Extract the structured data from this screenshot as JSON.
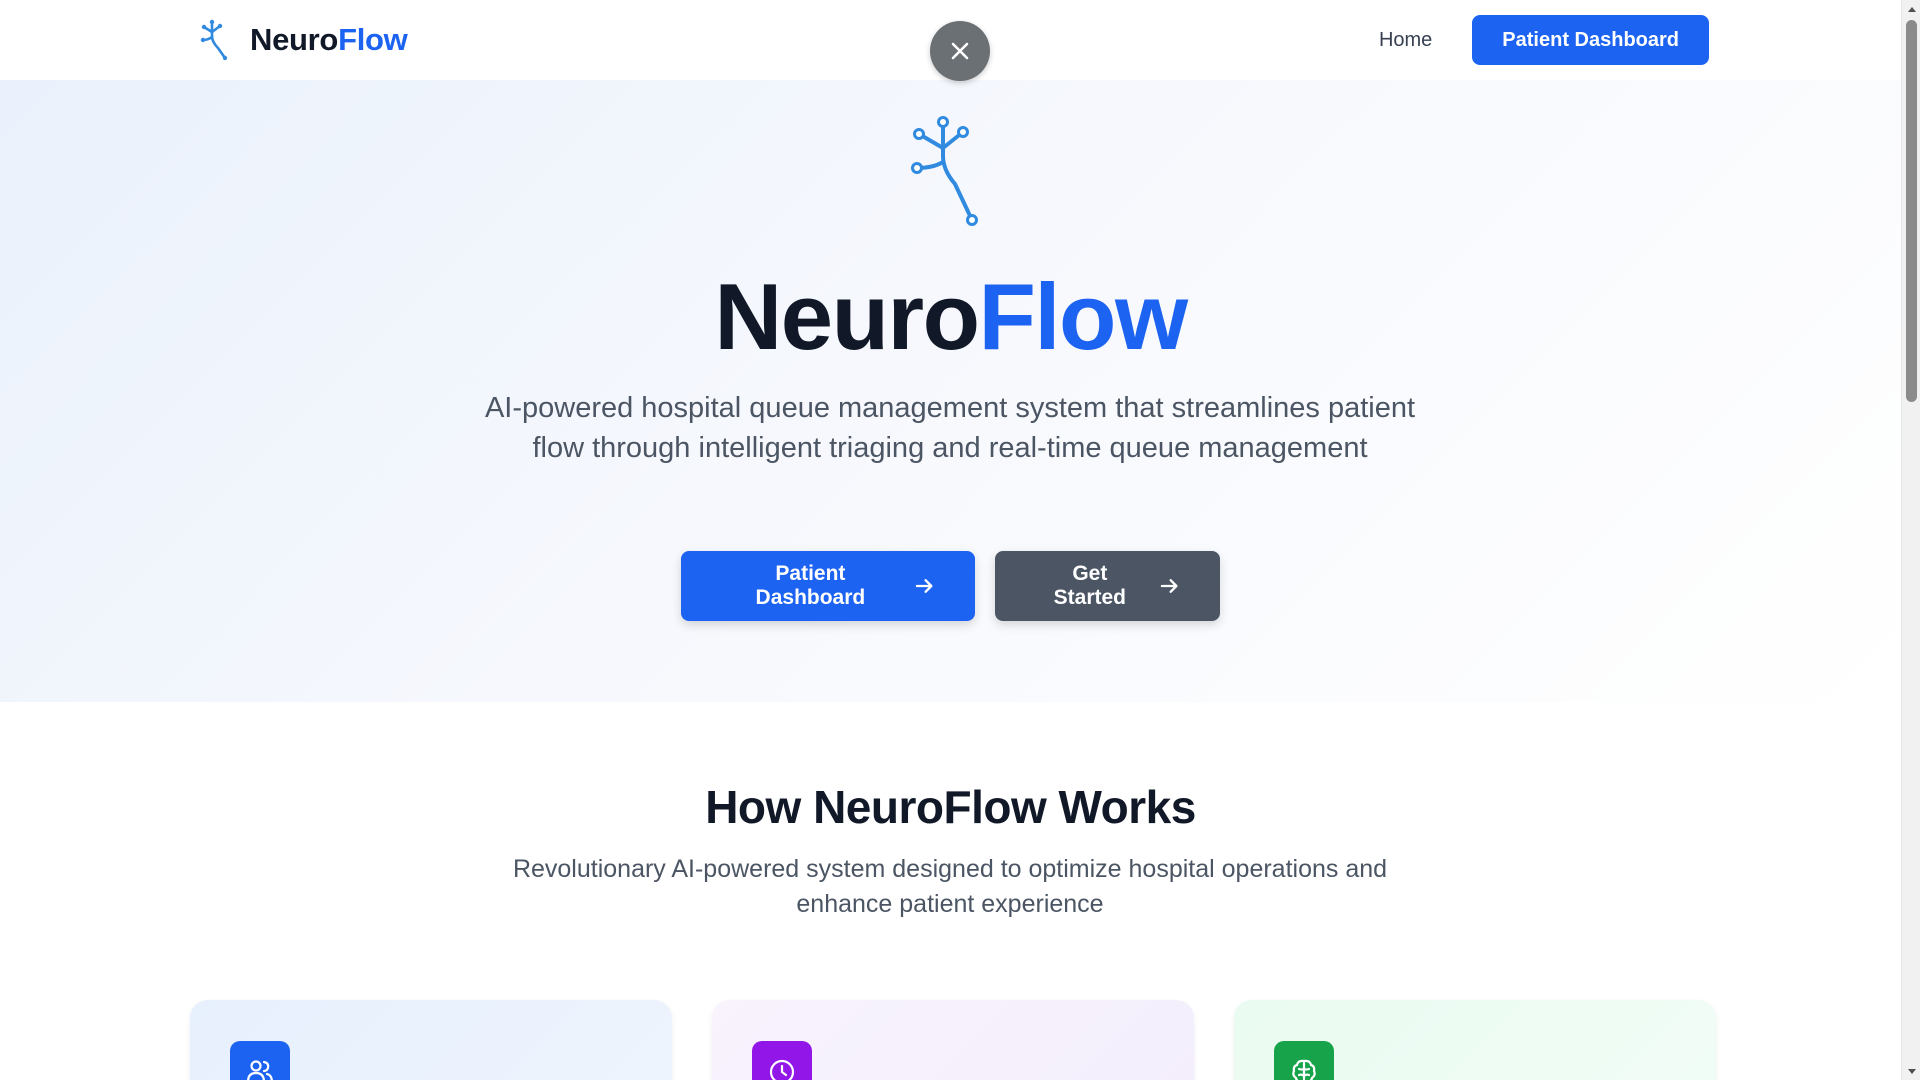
{
  "header": {
    "brand_part1": "Neuro",
    "brand_part2": "Flow",
    "nav_home": "Home",
    "nav_dashboard": "Patient Dashboard"
  },
  "hero": {
    "title_part1": "Neuro",
    "title_part2": "Flow",
    "subtitle": "AI-powered hospital queue management system that streamlines patient flow through intelligent triaging and real-time queue management",
    "primary_button": "Patient Dashboard",
    "secondary_button": "Get Started"
  },
  "section": {
    "title": "How NeuroFlow Works",
    "subtitle": "Revolutionary AI-powered system designed to optimize hospital operations and enhance patient experience"
  },
  "cards": [
    {
      "icon": "users-icon",
      "color": "#1d63f2"
    },
    {
      "icon": "clock-icon",
      "color": "#9216e8"
    },
    {
      "icon": "brain-icon",
      "color": "#16a34a"
    }
  ],
  "colors": {
    "accent": "#1d63f2",
    "dark_text": "#111827",
    "secondary_button": "#4b5563"
  }
}
